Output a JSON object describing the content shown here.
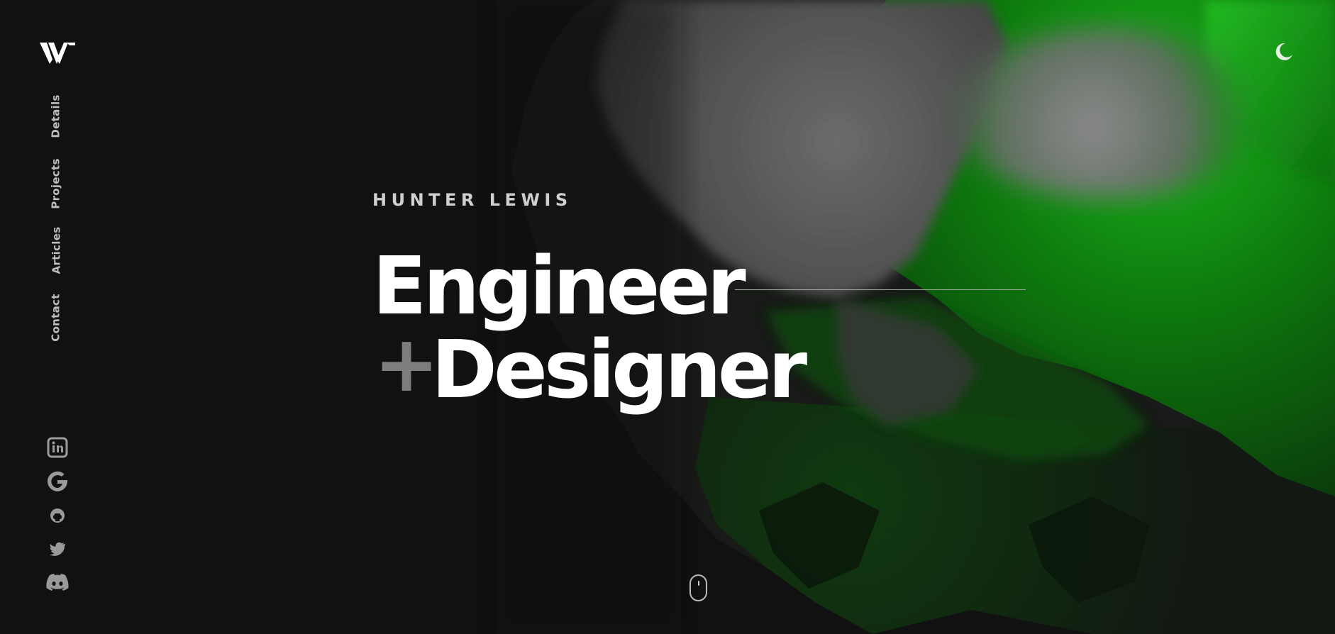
{
  "brand": {
    "logo_icon": "w-monogram-logo"
  },
  "nav": {
    "items": [
      {
        "label": "Details"
      },
      {
        "label": "Projects"
      },
      {
        "label": "Articles"
      },
      {
        "label": "Contact"
      }
    ]
  },
  "social": {
    "icons": [
      "linkedin-icon",
      "google-icon",
      "github-icon",
      "twitter-icon",
      "discord-icon"
    ]
  },
  "theme_toggle": {
    "icon": "moon-icon"
  },
  "hero": {
    "name": "HUNTER LEWIS",
    "title_line1": "Engineer",
    "title_plus": "+",
    "title_line2": "Designer"
  },
  "scroll_indicator": {
    "icon": "mouse-scroll-icon"
  },
  "colors": {
    "background": "#111111",
    "accent_green": "#1fa81f",
    "text_primary": "#ffffff",
    "text_muted": "#bdbdbd",
    "plus_gray": "#7d7d7d"
  }
}
